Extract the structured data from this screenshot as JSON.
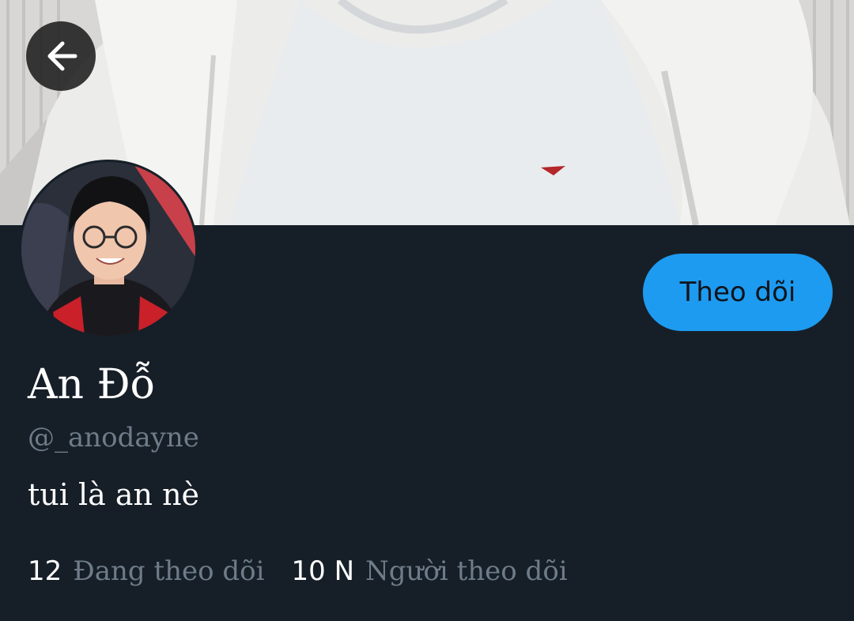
{
  "header": {
    "back_icon": "arrow-left-icon"
  },
  "profile": {
    "display_name": "An Đỗ",
    "username": "@_anodayne",
    "bio": "tui là an nè",
    "follow_label": "Theo dõi"
  },
  "stats": {
    "following_count": "12",
    "following_label": "Đang theo dõi",
    "followers_count": "10 N",
    "followers_label": "Người theo dõi"
  },
  "colors": {
    "background": "#161f28",
    "accent": "#1d9bf0",
    "secondary_text": "#6e7c89",
    "primary_text": "#ffffff"
  }
}
